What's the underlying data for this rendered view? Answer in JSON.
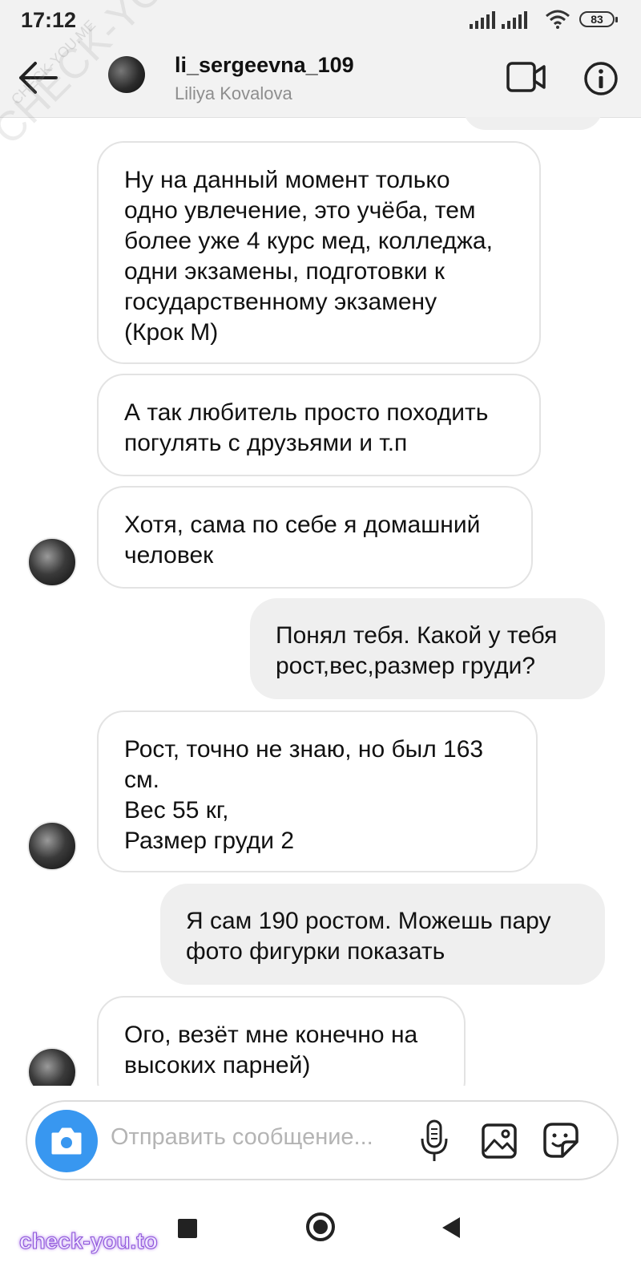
{
  "status_bar": {
    "time": "17:12",
    "battery": "83"
  },
  "header": {
    "username": "li_sergeevna_109",
    "full_name": "Liliya Kovalova"
  },
  "messages": [
    {
      "side": "in",
      "text": "Ну на данный момент только\nодно увлечение, это учёба, тем\nболее уже 4 курс мед, колледжа,\nодни экзамены, подготовки к\nгосударственному экзамену\n(Крок М)"
    },
    {
      "side": "in",
      "text": "А так любитель просто походить\nпогулять с друзьями и т.п"
    },
    {
      "side": "in",
      "text": "Хотя, сама по себе я домашний\nчеловек"
    },
    {
      "side": "out",
      "text": "Понял тебя. Какой у тебя\nрост,вес,размер груди?"
    },
    {
      "side": "in",
      "text": "Рост, точно не знаю, но был 163\nсм.\nВес 55 кг,\nРазмер груди 2"
    },
    {
      "side": "out",
      "text": "Я сам 190 ростом. Можешь пару\nфото фигурки показать"
    },
    {
      "side": "in",
      "text": "Ого, везёт мне конечно на\nвысоких парней)"
    }
  ],
  "composer": {
    "placeholder": "Отправить сообщение..."
  },
  "watermarks": {
    "footer": "check-you.to",
    "diagonal": "CHECK-YOU.ME",
    "diagonal_small": "CHECK-YOU.ME"
  },
  "colors": {
    "accent": "#3897f0",
    "incoming_border": "#e3e3e3",
    "outgoing_bg": "#efefef"
  }
}
